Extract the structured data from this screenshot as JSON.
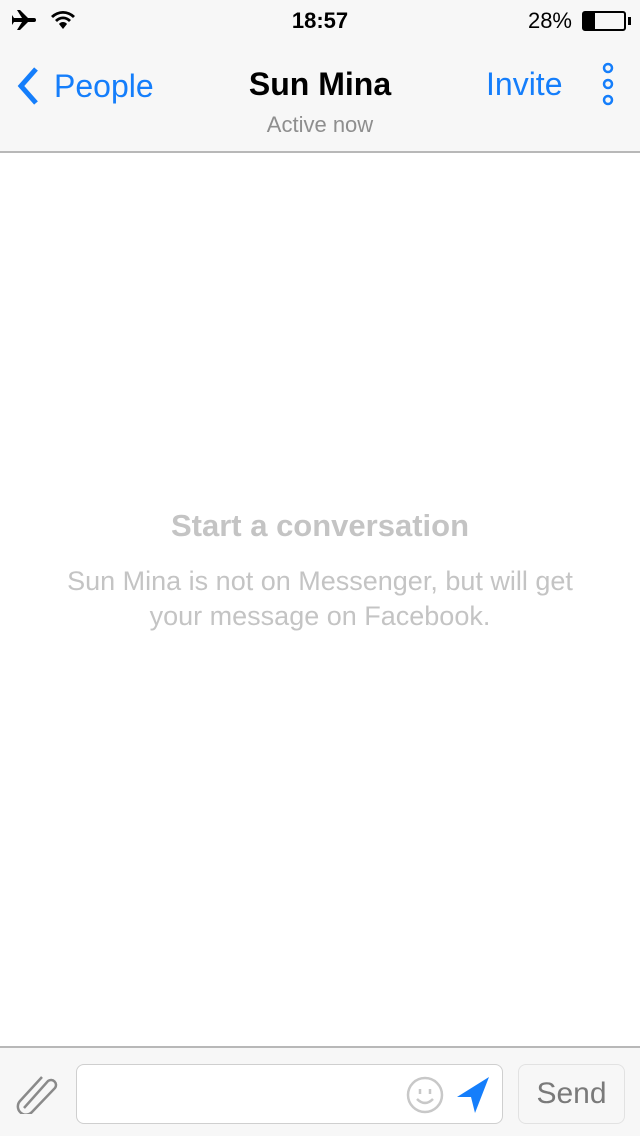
{
  "status_bar": {
    "time": "18:57",
    "battery_percent_label": "28%",
    "battery_level": 0.28
  },
  "header": {
    "back_label": "People",
    "title": "Sun Mina",
    "subtitle": "Active now",
    "invite_label": "Invite"
  },
  "empty_state": {
    "title": "Start a conversation",
    "message": "Sun Mina is not on Messenger, but will get your message on Facebook."
  },
  "composer": {
    "placeholder": "",
    "send_label": "Send"
  },
  "colors": {
    "accent": "#157efb"
  }
}
